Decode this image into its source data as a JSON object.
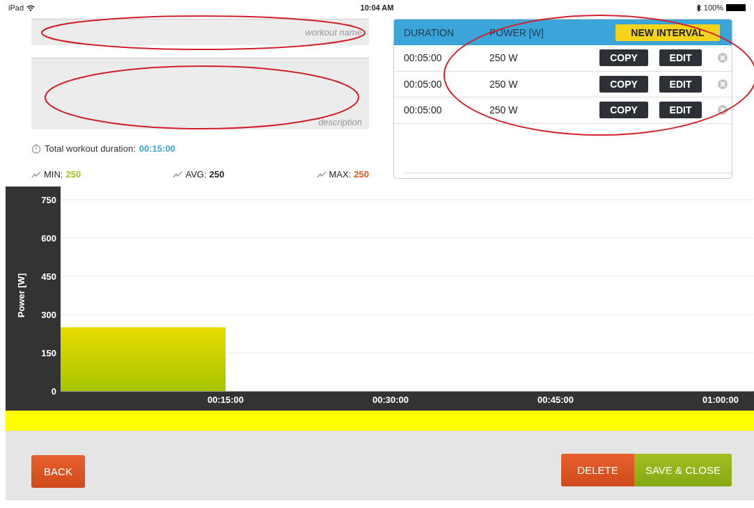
{
  "status_bar": {
    "device": "iPad",
    "time": "10:04 AM",
    "battery": "100%"
  },
  "workout_name": {
    "placeholder": "workout name"
  },
  "description": {
    "placeholder": "description"
  },
  "total_duration": {
    "label": "Total workout duration:",
    "value": "00:15:00"
  },
  "stats": [
    {
      "label": "MIN:",
      "value": "250",
      "color": "#9bc31c"
    },
    {
      "label": "AVG:",
      "value": "250",
      "color": "#222222"
    },
    {
      "label": "MAX:",
      "value": "250",
      "color": "#e0561e"
    }
  ],
  "intervals": {
    "columns": [
      "DURATION",
      "POWER [W]"
    ],
    "new_button": "NEW INTERVAL",
    "rows": [
      {
        "duration": "00:05:00",
        "power": "250 W",
        "copy": "COPY",
        "edit": "EDIT"
      },
      {
        "duration": "00:05:00",
        "power": "250 W",
        "copy": "COPY",
        "edit": "EDIT"
      },
      {
        "duration": "00:05:00",
        "power": "250 W",
        "copy": "COPY",
        "edit": "EDIT"
      }
    ]
  },
  "chart": {
    "chart_data": {
      "type": "area",
      "ylabel": "Power [W]",
      "x": [
        0,
        15
      ],
      "series": [
        {
          "color": "#a5c400",
          "values": [
            250,
            250
          ]
        }
      ],
      "grid": true,
      "xlim": [
        0,
        63
      ],
      "ylim": [
        0,
        750
      ],
      "xticks": [
        {
          "value": 15,
          "label": "00:15:00"
        },
        {
          "value": 30,
          "label": "00:30:00"
        },
        {
          "value": 45,
          "label": "00:45:00"
        },
        {
          "value": 60,
          "label": "01:00:00"
        }
      ],
      "yticks": [
        0,
        150,
        300,
        450,
        600,
        750
      ]
    }
  },
  "buttons": {
    "back": "BACK",
    "delete": "DELETE",
    "save": "SAVE & CLOSE"
  },
  "annotation_marks": [
    {
      "kind": "ellipse",
      "color": "#d0202a"
    },
    {
      "kind": "ellipse",
      "color": "#d0202a"
    },
    {
      "kind": "ellipse",
      "color": "#d0202a"
    }
  ]
}
